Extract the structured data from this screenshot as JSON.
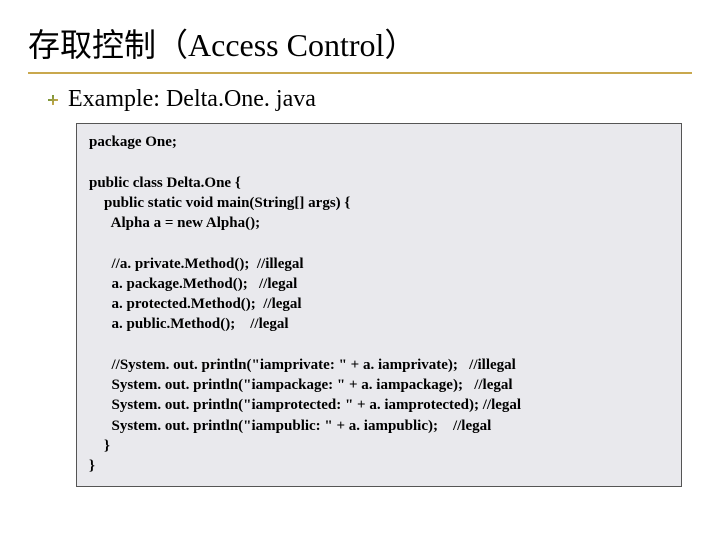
{
  "title": "存取控制（Access Control）",
  "example_label": "Example: Delta.One. java",
  "code": "package One;\n\npublic class Delta.One {\n    public static void main(String[] args) {\n      Alpha a = new Alpha();\n\n      //a. private.Method();  //illegal\n      a. package.Method();   //legal\n      a. protected.Method();  //legal\n      a. public.Method();    //legal\n\n      //System. out. println(\"iamprivate: \" + a. iamprivate);   //illegal\n      System. out. println(\"iampackage: \" + a. iampackage);   //legal\n      System. out. println(\"iamprotected: \" + a. iamprotected); //legal\n      System. out. println(\"iampublic: \" + a. iampublic);    //legal\n    }\n}"
}
